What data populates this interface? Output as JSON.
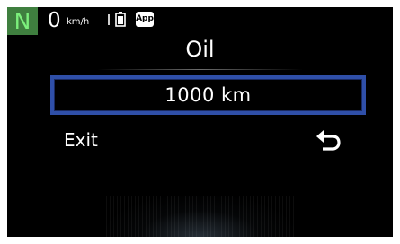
{
  "status_bar": {
    "gear": "N",
    "speed": "0",
    "speed_unit": "km/h",
    "app_badge": "App",
    "icons": [
      "signal-icon",
      "battery-icon",
      "app-icon"
    ]
  },
  "screen": {
    "title": "Oil",
    "value": "1000  km",
    "exit_label": "Exit",
    "back_icon": "return-arrow-icon"
  },
  "colors": {
    "gear_bg": "#3f7f3f",
    "gear_text": "#7cf07c",
    "box_border": "#2f4fa8",
    "background": "#000000",
    "text": "#ffffff"
  }
}
